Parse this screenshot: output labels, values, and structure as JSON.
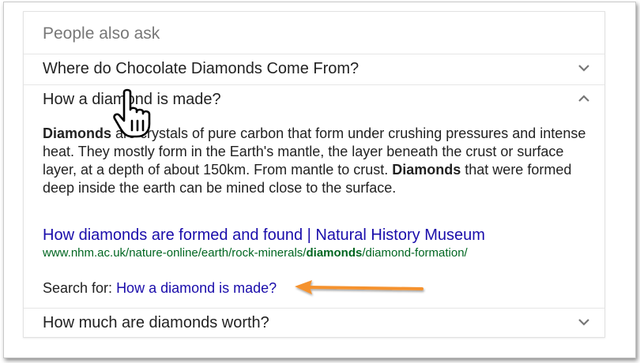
{
  "panel": {
    "heading": "People also ask",
    "questions": [
      {
        "label": "Where do Chocolate Diamonds Come From?",
        "expanded": false,
        "chevron_icon": "chevron-down-icon"
      },
      {
        "label": "How a diamond is made?",
        "expanded": true,
        "chevron_icon": "chevron-up-icon"
      },
      {
        "label": "How much are diamonds worth?",
        "expanded": false,
        "chevron_icon": "chevron-down-icon"
      }
    ],
    "answer": {
      "term": "Diamonds",
      "partial_text": "are crystals of pure carbon that form under crushing pressures and intense heat. They mostly form in the Earth's mantle, the layer beneath the crust or surface layer, at a depth of about 150km. From mantle to crust.",
      "term_2": "Diamonds",
      "text_2": "that were formed deep inside the earth can be mined close to the surface."
    },
    "source": {
      "title": "How diamonds are formed and found | Natural History Museum",
      "url_prefix": "www.nhm.ac.uk/nature-online/earth/rock-minerals/",
      "url_bold": "diamonds",
      "url_suffix": "/diamond-formation/"
    },
    "search_for": {
      "label": "Search for:",
      "link": "How a diamond is made?"
    }
  },
  "annotations": {
    "pointer": "hand-cursor-icon",
    "arrow": "arrow-icon",
    "arrow_color": "#f5922f"
  },
  "colors": {
    "link": "#1a0dab",
    "url": "#006621",
    "heading": "#777777",
    "text": "#222222"
  }
}
